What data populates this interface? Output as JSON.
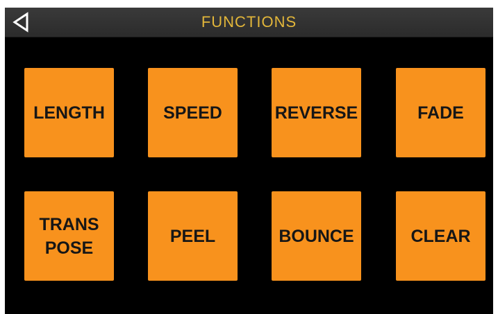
{
  "header": {
    "title": "FUNCTIONS",
    "back_icon": "back-triangle-icon",
    "title_color": "#e2b63a",
    "background": "#2f2f2f"
  },
  "pads": {
    "color": "#f8921d",
    "items": [
      {
        "label": "LENGTH"
      },
      {
        "label": "SPEED"
      },
      {
        "label": "REVERSE"
      },
      {
        "label": "FADE"
      },
      {
        "label": "TRANS\nPOSE"
      },
      {
        "label": "PEEL"
      },
      {
        "label": "BOUNCE"
      },
      {
        "label": "CLEAR"
      }
    ]
  }
}
